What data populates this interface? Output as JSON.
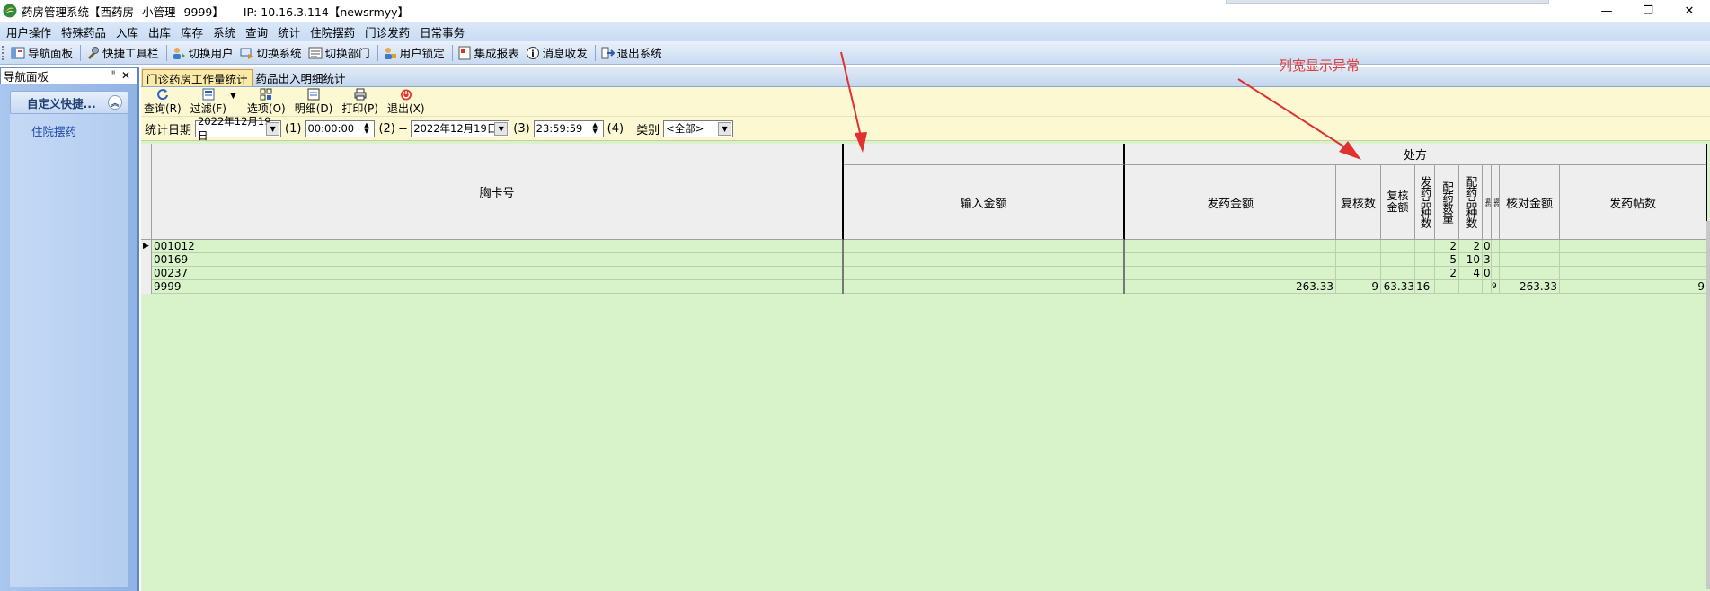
{
  "window": {
    "title": "药房管理系统【西药房--小管理--9999】---- IP: 10.16.3.114【newsrmyy】",
    "minimize": "—",
    "restore": "❐",
    "close": "✕"
  },
  "menu": [
    "用户操作",
    "特殊药品",
    "入库",
    "出库",
    "库存",
    "系统",
    "查询",
    "统计",
    "住院摆药",
    "门诊发药",
    "日常事务"
  ],
  "toolbar": [
    {
      "label": "导航面板",
      "icon": "nav-panel-icon"
    },
    {
      "label": "快捷工具栏",
      "icon": "quick-tools-icon"
    },
    {
      "label": "切换用户",
      "icon": "switch-user-icon"
    },
    {
      "label": "切换系统",
      "icon": "switch-system-icon"
    },
    {
      "label": "切换部门",
      "icon": "switch-dept-icon"
    },
    {
      "label": "用户锁定",
      "icon": "lock-user-icon"
    },
    {
      "label": "集成报表",
      "icon": "report-icon"
    },
    {
      "label": "消息收发",
      "icon": "message-icon"
    },
    {
      "label": "退出系统",
      "icon": "exit-icon"
    }
  ],
  "nav": {
    "header": "导航面板",
    "pin": "ᐦ",
    "close": "✕",
    "group": "自定义快捷...",
    "collapse": "︽",
    "items": [
      "住院摆药"
    ]
  },
  "tabs": [
    "门诊药房工作量统计",
    "药品出入明细统计"
  ],
  "inner_toolbar": [
    {
      "label": "查询(R)",
      "icon": "refresh-icon"
    },
    {
      "label": "过滤(F)",
      "icon": "filter-icon"
    },
    {
      "label": "选项(O)",
      "icon": "options-icon"
    },
    {
      "label": "明细(D)",
      "icon": "detail-icon"
    },
    {
      "label": "打印(P)",
      "icon": "print-icon"
    },
    {
      "label": "退出(X)",
      "icon": "exit-power-icon"
    }
  ],
  "filter": {
    "date_label": "统计日期",
    "start_date": "2022年12月19日",
    "mark1": "(1)",
    "start_time": "00:00:00",
    "mark2": "(2)",
    "dash": "--",
    "end_date": "2022年12月19日",
    "mark3": "(3)",
    "end_time": "23:59:59",
    "mark4": "(4)",
    "category_label": "类别",
    "category": "<全部>"
  },
  "grid": {
    "col_badge": "胸卡号",
    "group_blank": "",
    "group_chufang": "处方",
    "col_input": "输入金额",
    "col_send_amount": "发药金额",
    "col_recheck_count": "复核数",
    "col_recheck_amount": "复核金额",
    "col_send_kinds": "发药品种数",
    "col_dispense_qty": "配药数量",
    "col_dispense_kinds": "配药品种数",
    "col_x1": "退药",
    "col_x2": "退药",
    "col_check_amount": "核对金额",
    "col_send_posts": "发药帖数",
    "rows": [
      {
        "indicator": "▶",
        "badge": "001012",
        "input": "",
        "send_amount": "",
        "rc": "",
        "ra": "",
        "sk": "",
        "dq": "2",
        "dk": "2",
        "x1": "0",
        "check": "",
        "posts": ""
      },
      {
        "indicator": "",
        "badge": "00169",
        "input": "",
        "send_amount": "",
        "rc": "",
        "ra": "",
        "sk": "",
        "dq": "5",
        "dk": "10",
        "x1": "3",
        "check": "",
        "posts": ""
      },
      {
        "indicator": "",
        "badge": "00237",
        "input": "",
        "send_amount": "",
        "rc": "",
        "ra": "",
        "sk": "",
        "dq": "2",
        "dk": "4",
        "x1": "0",
        "check": "",
        "posts": ""
      },
      {
        "indicator": "",
        "badge": "9999",
        "input": "",
        "send_amount": "263.33",
        "rc": "9",
        "ra": "63.33",
        "sk": "16",
        "dq": "",
        "dk": "",
        "x1": "",
        "x2": "9",
        "check": "263.33",
        "posts": "9"
      }
    ]
  },
  "annotation": "列宽显示异常",
  "colors": {
    "annotation": "#e04040",
    "grid_bg": "#d8f3ca",
    "inner_bg": "#fbf8d2"
  }
}
